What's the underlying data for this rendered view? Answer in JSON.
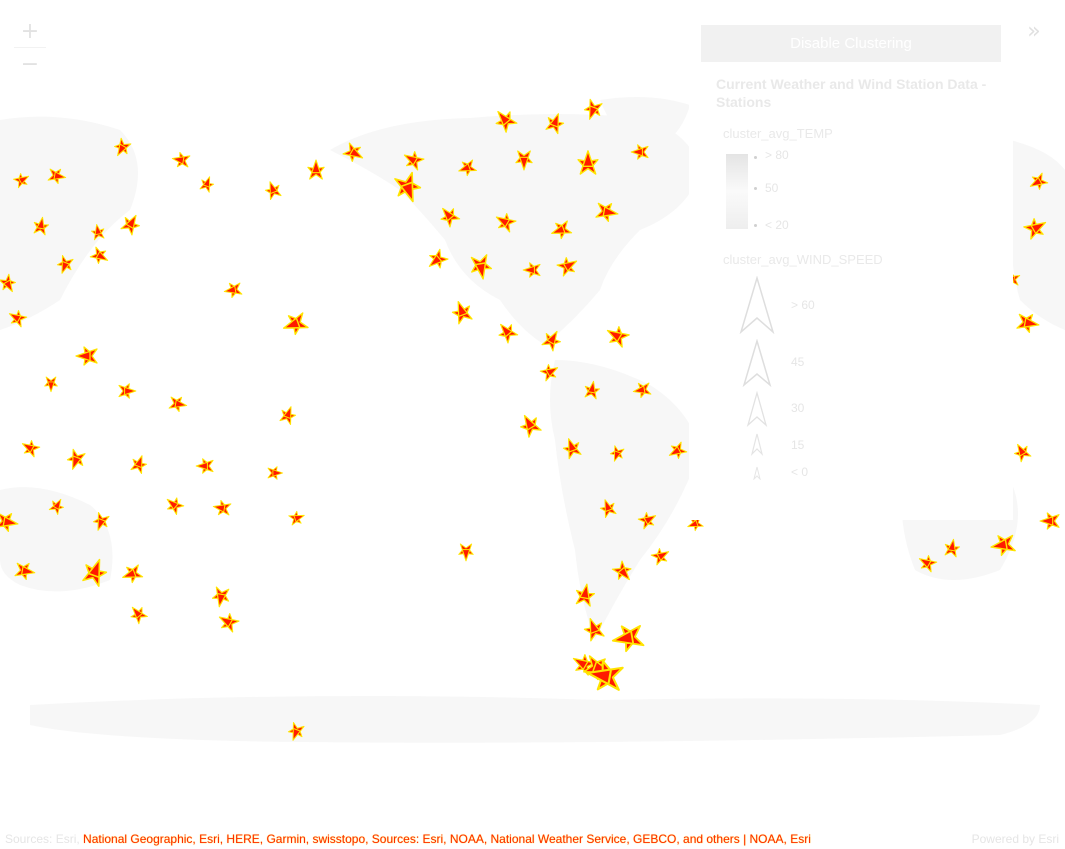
{
  "map": {
    "land_color": "#f7f7f7",
    "marker_fill": "#ff1a00",
    "marker_stroke": "#ffe400"
  },
  "controls": {
    "zoom_in": "+",
    "zoom_out": "−",
    "expand": "»",
    "cluster_button": "Disable Clustering"
  },
  "legend": {
    "title": "Current Weather and Wind Station Data - Stations",
    "temp_field": "cluster_avg_TEMP",
    "temp_labels": [
      "> 80",
      "50",
      "< 20"
    ],
    "wind_field": "cluster_avg_WIND_SPEED",
    "wind_labels": [
      "> 60",
      "45",
      "30",
      "15",
      "< 0"
    ]
  },
  "attribution": {
    "prefix": "Sources: Esri, ",
    "highlight": "National Geographic, Esri, HERE, Garmin, swisstopo, Sources: Esri, NOAA, National Weather Service, GEBCO, and others | NOAA, Esri",
    "powered": "Powered by Esri"
  }
}
